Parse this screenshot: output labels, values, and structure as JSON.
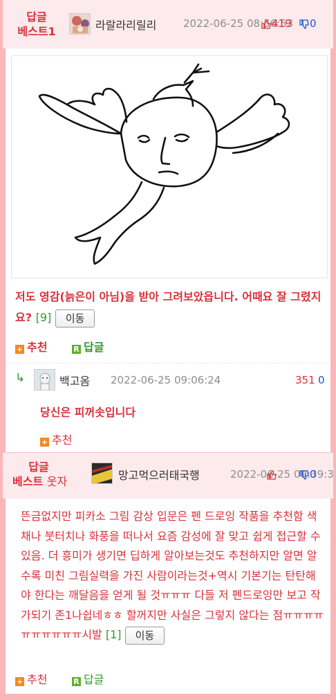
{
  "post1": {
    "badge_line1": "답글",
    "badge_line2": "베스트1",
    "nickname": "라랄라리릴리",
    "date": "2022-06-25 08:56:53",
    "up_count": "419",
    "down_count": "0",
    "text": "저도 영감(늙은이 아님)을 받아 그려보았읍니다. 어때요 잘 그렸지요?",
    "comment_count": "[9]",
    "move_label": "이동",
    "recommend_label": "추천",
    "reply_label": "답글"
  },
  "reply1": {
    "arrow": "↳",
    "nickname": "백고옴",
    "date": "2022-06-25 09:06:24",
    "up_count": "351",
    "down_count": "0",
    "text": "당신은 피꺼솟입니다",
    "recommend_label": "추천"
  },
  "post2": {
    "badge_line1": "답글",
    "badge_line2": "베스트",
    "badge_suffix": "웃자",
    "nickname": "망고먹으러태국행",
    "date": "2022-06-25 09:39:3",
    "up_count": "",
    "down_count": "0",
    "text": "뜬금없지만 피카소 그림 감상 입문은 펜 드로잉 작품을 추천함 색채나 붓터치나 화풍을 떠나서 요즘 감성에 잘 맞고 쉽게 접근할 수 있음. 더 흥미가 생기면 딥하게 알아보는것도 추천하지만 알면 알수록 미친 그림실력을 가진 사람이라는것+역시 기본기는 탄탄해야 한다는 깨달음을 얻게 될 것ㅠㅠㅠ 다들 저 펜드로잉만 보고 작가되기 존1나쉽네ㅎㅎ 할꺼지만 사실은 그렇지 않다는 점ㅠㅠㅠㅠㅠㅠㅠㅠㅠㅠ시발",
    "comment_count": "[1]",
    "move_label": "이동",
    "recommend_label": "추천",
    "reply_label": "답글"
  },
  "colors": {
    "accent": "#d9313a",
    "header_bg": "#fdeaec",
    "border": "#fbb6ba",
    "green": "#2e9b2e",
    "blue": "#1a57c8"
  }
}
